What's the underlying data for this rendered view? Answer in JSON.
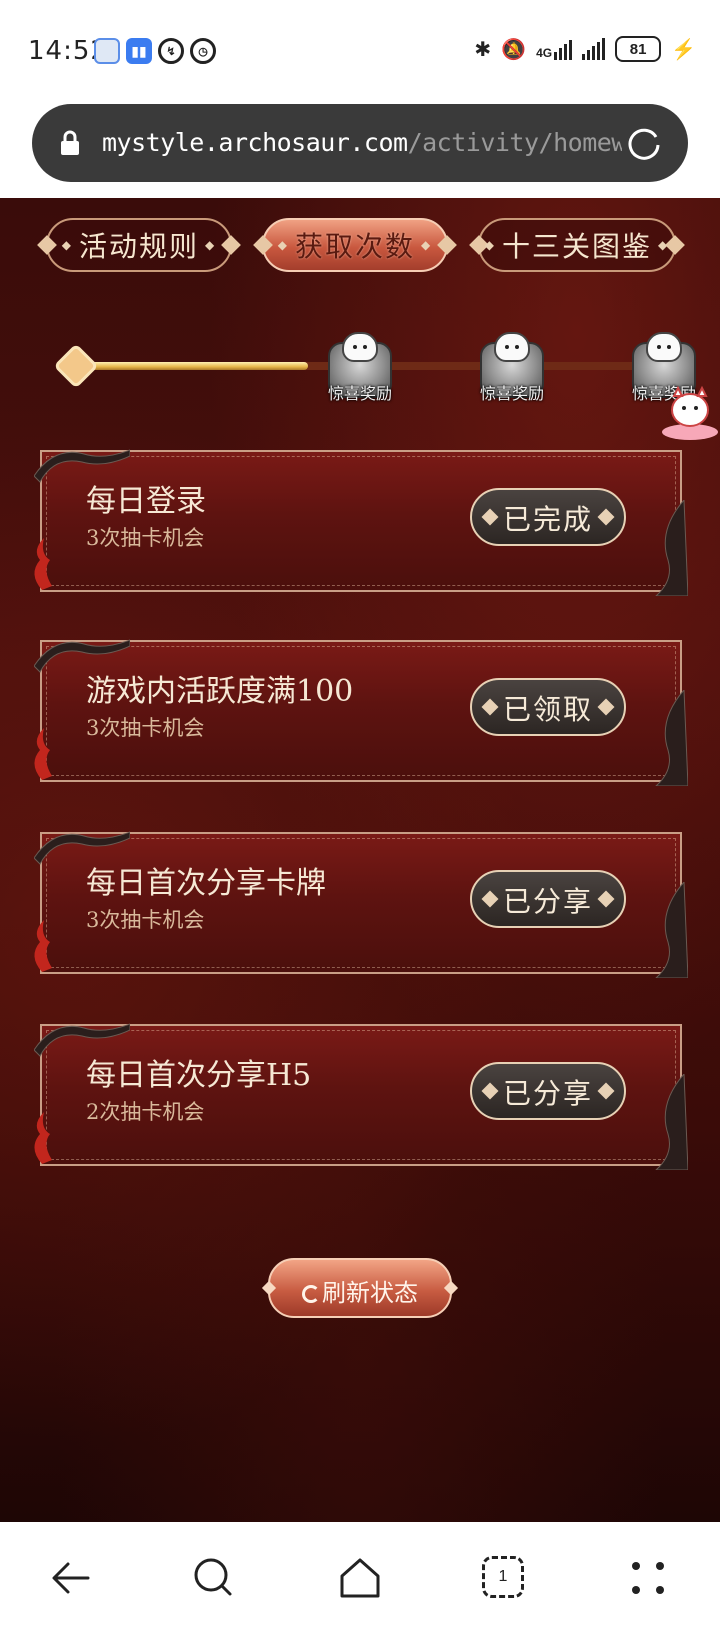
{
  "status_bar": {
    "time": "14:52",
    "battery_level": "81",
    "network": "4G",
    "icons": [
      "message-icon",
      "app-icon",
      "data-saver-icon",
      "alarm-icon",
      "bluetooth-icon",
      "mute-icon",
      "signal-4g-icon",
      "signal-icon",
      "battery-icon",
      "charging-icon"
    ]
  },
  "address_bar": {
    "url_host": "mystyle.archosaur.com",
    "url_path": "/activity/homeware",
    "icons": [
      "lock-icon",
      "reload-icon"
    ]
  },
  "tabs": [
    {
      "label": "活动规则",
      "active": false
    },
    {
      "label": "获取次数",
      "active": true
    },
    {
      "label": "十三关图鉴",
      "active": false
    }
  ],
  "progress": {
    "fill_fraction": 0.38,
    "milestones": [
      {
        "label": "惊喜奖励"
      },
      {
        "label": "惊喜奖励"
      },
      {
        "label": "惊喜奖励"
      }
    ]
  },
  "tasks": [
    {
      "title": "每日登录",
      "reward": "3次抽卡机会",
      "status": "已完成"
    },
    {
      "title": "游戏内活跃度满100",
      "reward": "3次抽卡机会",
      "status": "已领取"
    },
    {
      "title": "每日首次分享卡牌",
      "reward": "3次抽卡机会",
      "status": "已分享"
    },
    {
      "title": "每日首次分享H5",
      "reward": "2次抽卡机会",
      "status": "已分享"
    }
  ],
  "refresh": {
    "label": "刷新状态"
  },
  "colors": {
    "page_bg": "#4a0f0c",
    "gold": "#e6b64a",
    "accent_tab": "#c9583f",
    "status_button": "#2c2623"
  },
  "bottom_nav": {
    "icons": [
      "back-icon",
      "search-icon",
      "home-icon",
      "tabs-icon",
      "menu-icon"
    ],
    "tab_count": "1"
  }
}
